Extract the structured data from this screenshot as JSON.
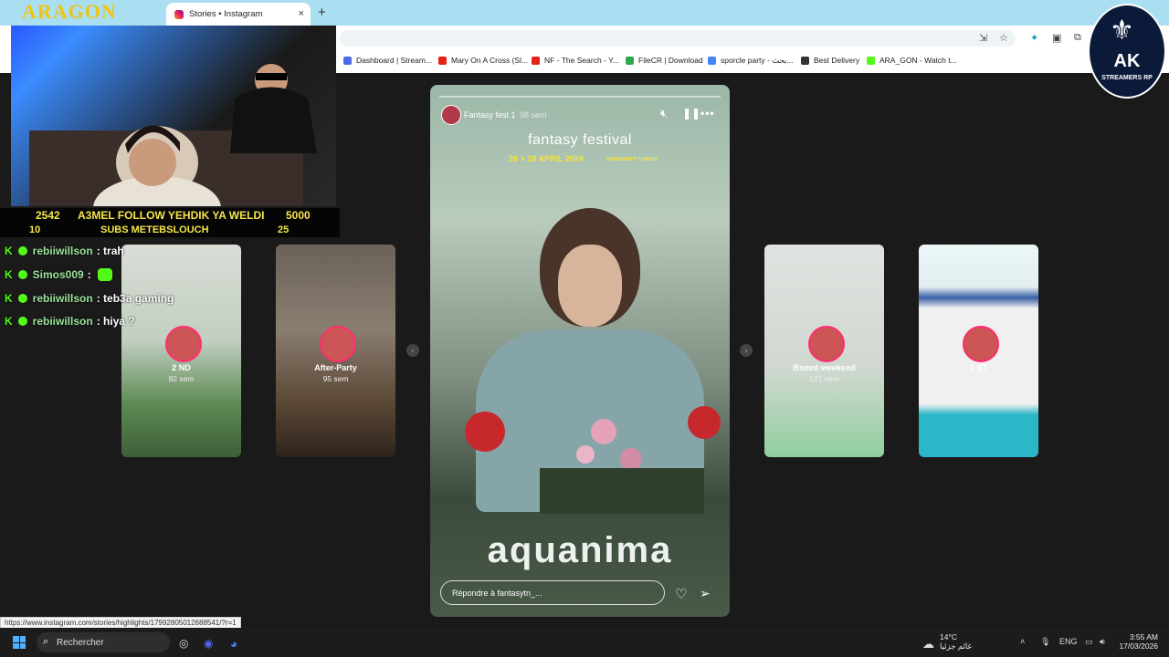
{
  "browser": {
    "tab_title": "Stories • Instagram",
    "tab_close": "×",
    "new_tab": "+",
    "bookmarks": [
      {
        "label": "Dashboard | Stream...",
        "color": "#4b6ce6"
      },
      {
        "label": "Mary On A Cross (Sl...",
        "color": "#e62117"
      },
      {
        "label": "NF - The Search - Y...",
        "color": "#e62117"
      },
      {
        "label": "FileCR | Download",
        "color": "#2fa84f"
      },
      {
        "label": "sporcle party - بحث...",
        "color": "#4285f4"
      },
      {
        "label": "Best Delivery",
        "color": "#333333"
      },
      {
        "label": "ARA_GON - Watch t...",
        "color": "#53fc18"
      }
    ]
  },
  "stream_overlay": {
    "logo": "ARAGON",
    "follow_count": "2542",
    "follow_text": "A3MEL FOLLOW YEHDIK YA WELDI",
    "follow_goal": "5000",
    "subs_count": "10",
    "subs_text": "SUBS METEBSLOUCH",
    "subs_goal": "25",
    "badge": {
      "title": "AK",
      "subtitle": "STREAMERS RP"
    },
    "chat": [
      {
        "user": "rebiiwillson",
        "message": "trah"
      },
      {
        "user": "Simos009",
        "message": ""
      },
      {
        "user": "rebiiwillson",
        "message": "teb3a gaming"
      },
      {
        "user": "rebiiwillson",
        "message": "hiya ?"
      }
    ]
  },
  "stories": {
    "side_cards": [
      {
        "name": "2 ND",
        "age": "82 sem",
        "bg": "#6a8a5a"
      },
      {
        "name": "After-Party",
        "age": "95 sem",
        "bg": "#5a4a3a"
      },
      {
        "name": "Bsmnt weekend",
        "age": "121 sem",
        "bg": "#c9d6c8"
      },
      {
        "name": "1 ST",
        "age": "137 sem",
        "bg": "#2cb7c9"
      }
    ],
    "main": {
      "username": "Fantasy fest 1",
      "time": "98 sem",
      "title": "fantasy festival",
      "date": "26 > 28 APRIL 2024",
      "location": "HAMMAMET TUNISIA",
      "brand": "aquanima",
      "reply_placeholder": "Répondre à fantasytn_..."
    }
  },
  "status_url": "https://www.instagram.com/stories/highlights/17992805012688541/?r=1",
  "taskbar": {
    "search": "Rechercher",
    "weather_temp": "14°C",
    "weather_desc": "غائم جزئيا",
    "lang": "ENG",
    "time": "3:55 AM",
    "date": "17/03/2026"
  }
}
